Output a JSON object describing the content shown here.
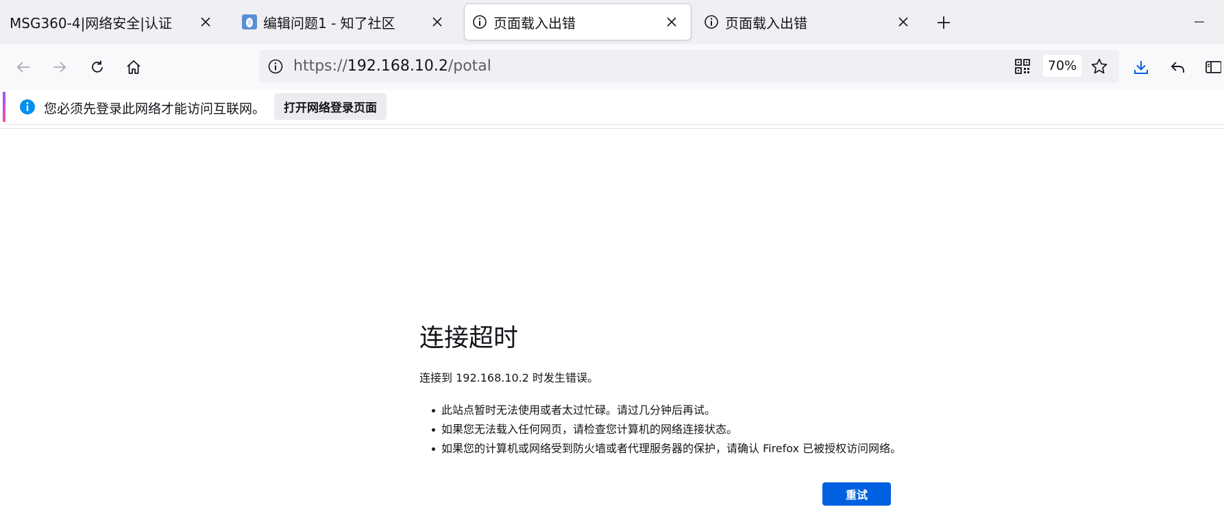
{
  "tabs": [
    {
      "title": "MSG360-4|网络安全|认证",
      "favicon": "none",
      "active": false
    },
    {
      "title": "编辑问题1 - 知了社区",
      "favicon": "site-logo-icon",
      "active": false
    },
    {
      "title": "页面载入出错",
      "favicon": "info-icon",
      "active": true
    },
    {
      "title": "页面载入出错",
      "favicon": "info-icon",
      "active": false
    }
  ],
  "toolbar": {
    "url_scheme": "https://",
    "url_host": "192.168.10.2",
    "url_path": "/potal",
    "zoom": "70%"
  },
  "notification": {
    "message": "您必须先登录此网络才能访问互联网。",
    "button_label": "打开网络登录页面"
  },
  "error_page": {
    "title": "连接超时",
    "description": "连接到 192.168.10.2 时发生错误。",
    "suggestions": [
      "此站点暂时无法使用或者太过忙碌。请过几分钟后再试。",
      "如果您无法载入任何网页，请检查您计算机的网络连接状态。",
      "如果您的计算机或网络受到防火墙或者代理服务器的保护，请确认 Firefox 已被授权访问网络。"
    ],
    "retry_label": "重试"
  },
  "colors": {
    "accent": "#0061e0",
    "info_blue": "#0090ed",
    "tabbar_bg": "#f0f0f4",
    "text": "#15141a"
  }
}
